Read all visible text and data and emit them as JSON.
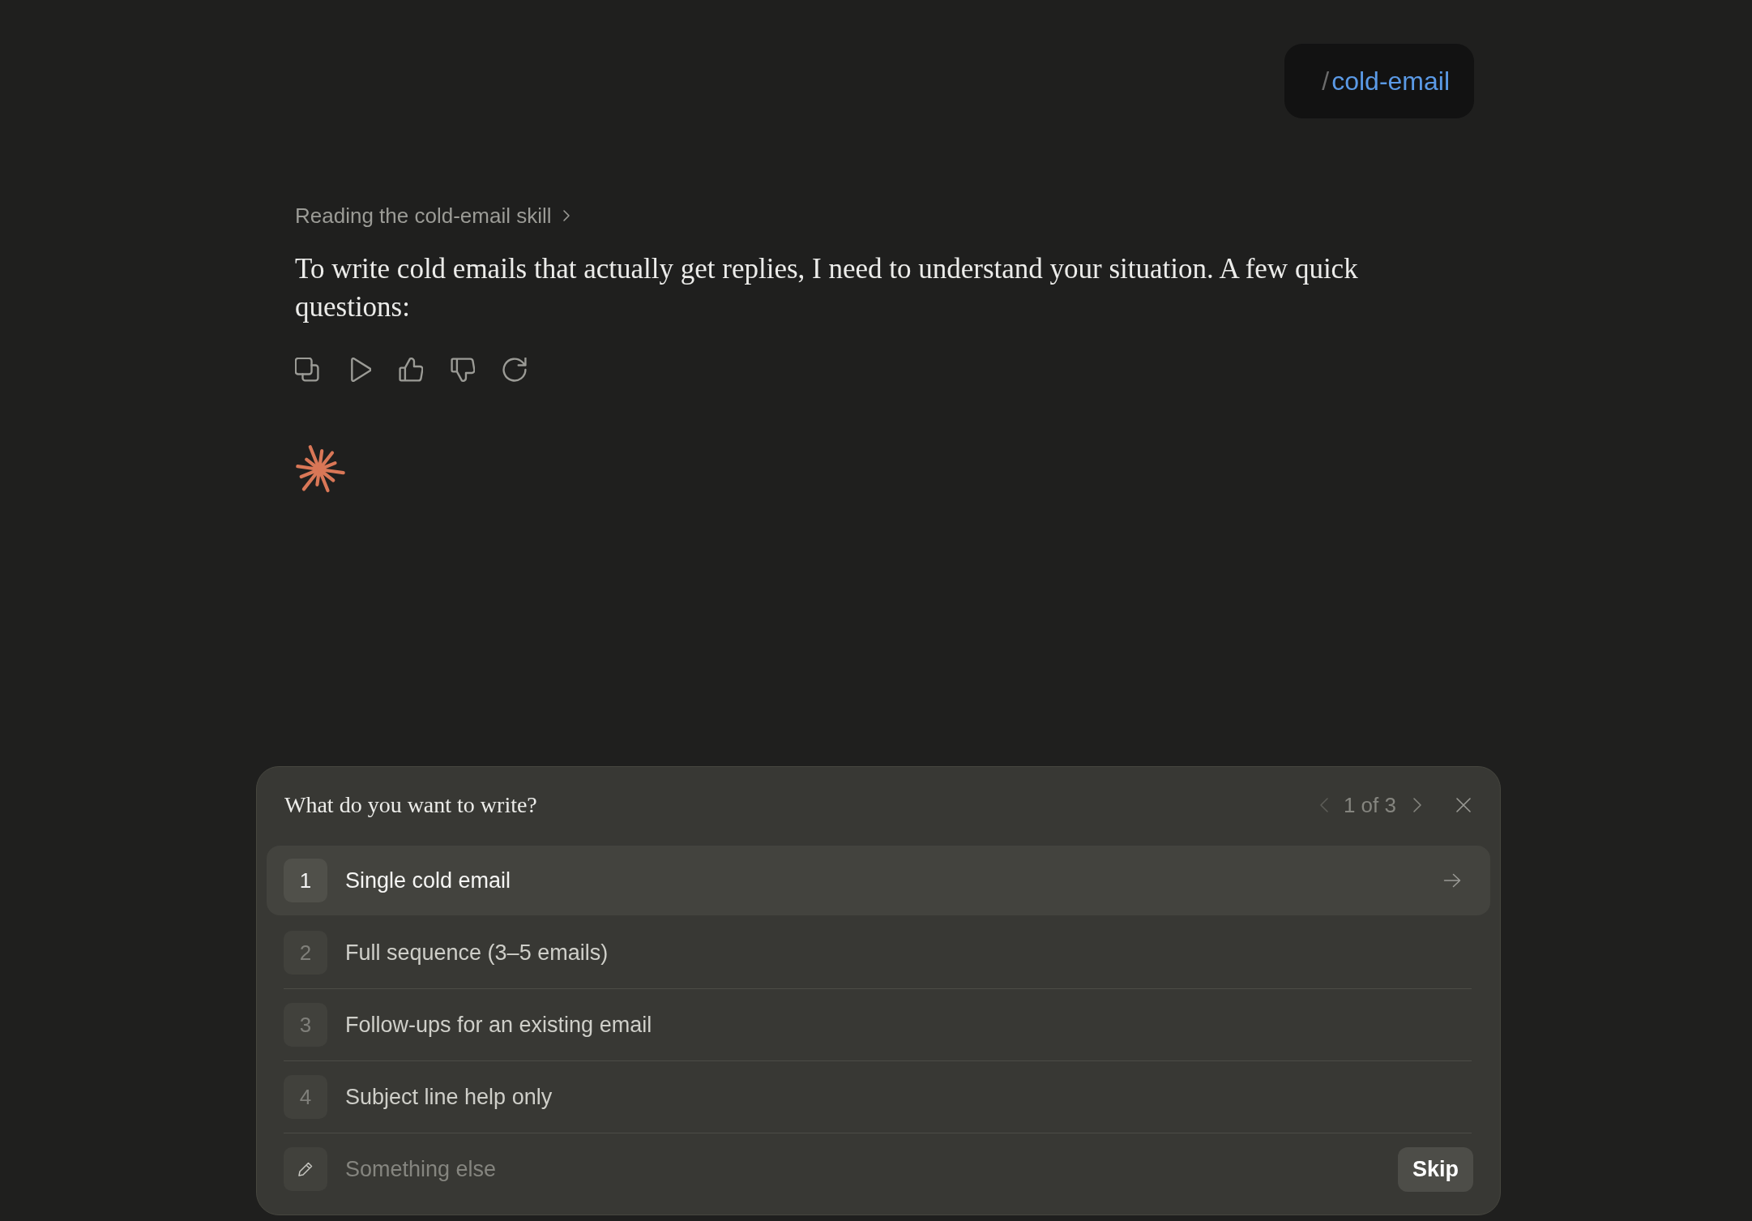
{
  "user_message": {
    "slash": "/",
    "command": "cold-email"
  },
  "status_line": {
    "text": "Reading the cold-email skill"
  },
  "response": {
    "text": "To write cold emails that actually get replies, I need to understand your situation. A few quick questions:"
  },
  "question_panel": {
    "title": "What do you want to write?",
    "pager": {
      "text": "1 of 3",
      "prev_disabled": true
    },
    "options": [
      {
        "number": "1",
        "label": "Single cold email",
        "selected": true
      },
      {
        "number": "2",
        "label": "Full sequence (3–5 emails)",
        "selected": false
      },
      {
        "number": "3",
        "label": "Follow-ups for an existing email",
        "selected": false
      },
      {
        "number": "4",
        "label": "Subject line help only",
        "selected": false
      }
    ],
    "other": {
      "placeholder": "Something else"
    },
    "skip_button": "Skip"
  }
}
